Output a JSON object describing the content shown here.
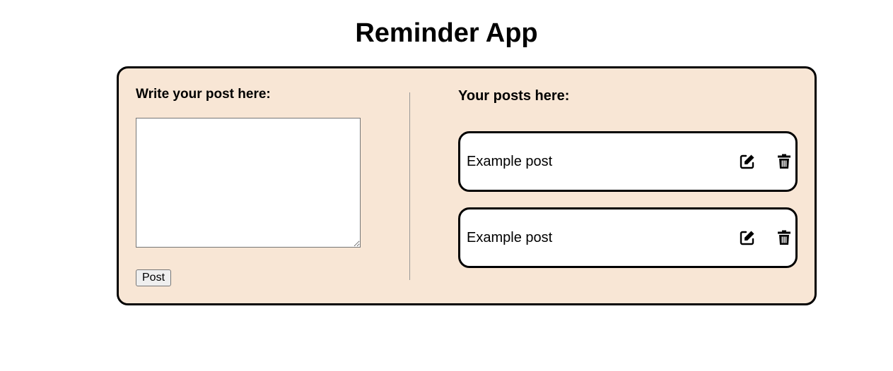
{
  "header": {
    "title": "Reminder App"
  },
  "composer": {
    "heading": "Write your post here:",
    "textarea_value": "",
    "post_button_label": "Post"
  },
  "posts": {
    "heading": "Your posts here:",
    "items": [
      {
        "text": "Example post",
        "actions": [
          "edit-icon",
          "trash-icon"
        ]
      },
      {
        "text": "Example post",
        "actions": [
          "edit-icon",
          "trash-icon"
        ]
      }
    ]
  },
  "colors": {
    "card_background": "#f8e6d5",
    "border": "#000000",
    "post_background": "#ffffff"
  }
}
